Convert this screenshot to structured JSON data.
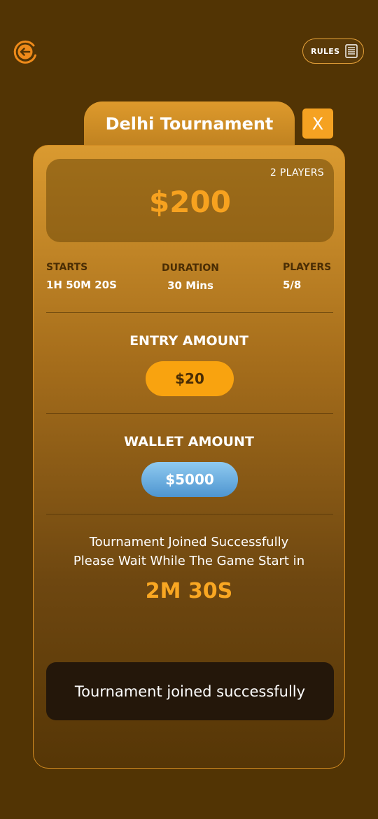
{
  "header": {
    "rules_label": "RULES"
  },
  "tournament": {
    "title": "Delhi Tournament",
    "close_label": "X",
    "prize_players": "2 PLAYERS",
    "prize_amount": "$200"
  },
  "stats": {
    "starts_label": "STARTS",
    "starts_value": "1H 50M 20S",
    "duration_label": "DURATION",
    "duration_value": "30 Mins",
    "players_label": "PLAYERS",
    "players_value": "5/8"
  },
  "entry": {
    "title": "ENTRY AMOUNT",
    "amount": "$20"
  },
  "wallet": {
    "title": "WALLET AMOUNT",
    "amount": "$5000"
  },
  "status": {
    "line1": "Tournament Joined Successfully",
    "line2": "Please Wait While The Game Start in",
    "countdown": "2M 30S"
  },
  "toast": {
    "message": "Tournament joined successfully"
  },
  "colors": {
    "background": "#523404",
    "accent": "#F5A222",
    "wallet": "#5BA3DC",
    "toast": "#24170A"
  },
  "icons": {
    "back": "back-arrow-circle-icon",
    "rules": "document-list-icon"
  }
}
